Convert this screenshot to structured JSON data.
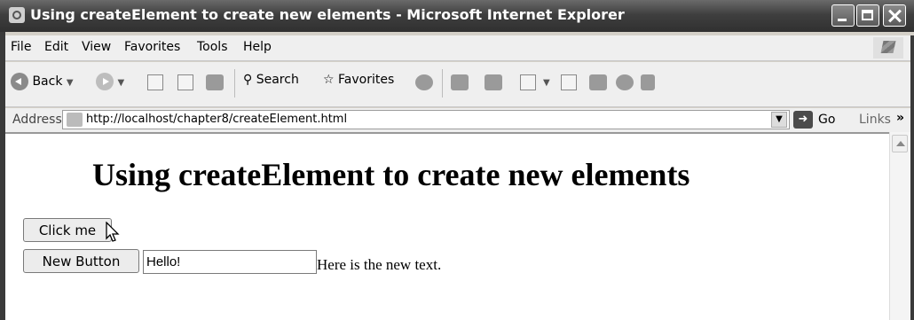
{
  "window": {
    "title": "Using createElement to create new elements - Microsoft Internet Explorer"
  },
  "menu": {
    "items": [
      "File",
      "Edit",
      "View",
      "Favorites",
      "Tools",
      "Help"
    ]
  },
  "toolbar": {
    "back_label": "Back",
    "search_label": "Search",
    "favorites_label": "Favorites"
  },
  "address": {
    "label": "Address",
    "url": "http://localhost/chapter8/createElement.html",
    "go_label": "Go",
    "links_label": "Links"
  },
  "page": {
    "heading": "Using createElement to create new elements",
    "click_button_label": "Click me",
    "new_button_label": "New Button",
    "input_value": "Hello!",
    "new_text": "Here is the new text."
  }
}
